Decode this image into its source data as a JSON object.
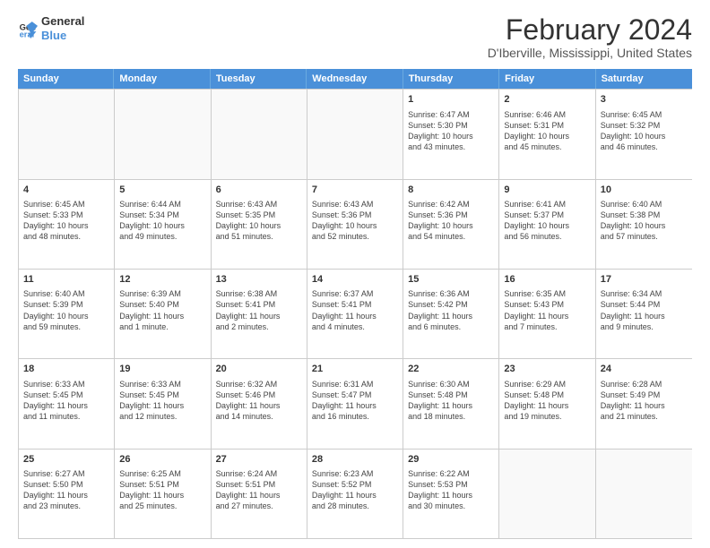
{
  "logo": {
    "line1": "General",
    "line2": "Blue"
  },
  "title": "February 2024",
  "location": "D'Iberville, Mississippi, United States",
  "days_of_week": [
    "Sunday",
    "Monday",
    "Tuesday",
    "Wednesday",
    "Thursday",
    "Friday",
    "Saturday"
  ],
  "weeks": [
    [
      {
        "day": "",
        "empty": true
      },
      {
        "day": "",
        "empty": true
      },
      {
        "day": "",
        "empty": true
      },
      {
        "day": "",
        "empty": true
      },
      {
        "day": "1",
        "line1": "Sunrise: 6:47 AM",
        "line2": "Sunset: 5:30 PM",
        "line3": "Daylight: 10 hours",
        "line4": "and 43 minutes."
      },
      {
        "day": "2",
        "line1": "Sunrise: 6:46 AM",
        "line2": "Sunset: 5:31 PM",
        "line3": "Daylight: 10 hours",
        "line4": "and 45 minutes."
      },
      {
        "day": "3",
        "line1": "Sunrise: 6:45 AM",
        "line2": "Sunset: 5:32 PM",
        "line3": "Daylight: 10 hours",
        "line4": "and 46 minutes."
      }
    ],
    [
      {
        "day": "4",
        "line1": "Sunrise: 6:45 AM",
        "line2": "Sunset: 5:33 PM",
        "line3": "Daylight: 10 hours",
        "line4": "and 48 minutes."
      },
      {
        "day": "5",
        "line1": "Sunrise: 6:44 AM",
        "line2": "Sunset: 5:34 PM",
        "line3": "Daylight: 10 hours",
        "line4": "and 49 minutes."
      },
      {
        "day": "6",
        "line1": "Sunrise: 6:43 AM",
        "line2": "Sunset: 5:35 PM",
        "line3": "Daylight: 10 hours",
        "line4": "and 51 minutes."
      },
      {
        "day": "7",
        "line1": "Sunrise: 6:43 AM",
        "line2": "Sunset: 5:36 PM",
        "line3": "Daylight: 10 hours",
        "line4": "and 52 minutes."
      },
      {
        "day": "8",
        "line1": "Sunrise: 6:42 AM",
        "line2": "Sunset: 5:36 PM",
        "line3": "Daylight: 10 hours",
        "line4": "and 54 minutes."
      },
      {
        "day": "9",
        "line1": "Sunrise: 6:41 AM",
        "line2": "Sunset: 5:37 PM",
        "line3": "Daylight: 10 hours",
        "line4": "and 56 minutes."
      },
      {
        "day": "10",
        "line1": "Sunrise: 6:40 AM",
        "line2": "Sunset: 5:38 PM",
        "line3": "Daylight: 10 hours",
        "line4": "and 57 minutes."
      }
    ],
    [
      {
        "day": "11",
        "line1": "Sunrise: 6:40 AM",
        "line2": "Sunset: 5:39 PM",
        "line3": "Daylight: 10 hours",
        "line4": "and 59 minutes."
      },
      {
        "day": "12",
        "line1": "Sunrise: 6:39 AM",
        "line2": "Sunset: 5:40 PM",
        "line3": "Daylight: 11 hours",
        "line4": "and 1 minute."
      },
      {
        "day": "13",
        "line1": "Sunrise: 6:38 AM",
        "line2": "Sunset: 5:41 PM",
        "line3": "Daylight: 11 hours",
        "line4": "and 2 minutes."
      },
      {
        "day": "14",
        "line1": "Sunrise: 6:37 AM",
        "line2": "Sunset: 5:41 PM",
        "line3": "Daylight: 11 hours",
        "line4": "and 4 minutes."
      },
      {
        "day": "15",
        "line1": "Sunrise: 6:36 AM",
        "line2": "Sunset: 5:42 PM",
        "line3": "Daylight: 11 hours",
        "line4": "and 6 minutes."
      },
      {
        "day": "16",
        "line1": "Sunrise: 6:35 AM",
        "line2": "Sunset: 5:43 PM",
        "line3": "Daylight: 11 hours",
        "line4": "and 7 minutes."
      },
      {
        "day": "17",
        "line1": "Sunrise: 6:34 AM",
        "line2": "Sunset: 5:44 PM",
        "line3": "Daylight: 11 hours",
        "line4": "and 9 minutes."
      }
    ],
    [
      {
        "day": "18",
        "line1": "Sunrise: 6:33 AM",
        "line2": "Sunset: 5:45 PM",
        "line3": "Daylight: 11 hours",
        "line4": "and 11 minutes."
      },
      {
        "day": "19",
        "line1": "Sunrise: 6:33 AM",
        "line2": "Sunset: 5:45 PM",
        "line3": "Daylight: 11 hours",
        "line4": "and 12 minutes."
      },
      {
        "day": "20",
        "line1": "Sunrise: 6:32 AM",
        "line2": "Sunset: 5:46 PM",
        "line3": "Daylight: 11 hours",
        "line4": "and 14 minutes."
      },
      {
        "day": "21",
        "line1": "Sunrise: 6:31 AM",
        "line2": "Sunset: 5:47 PM",
        "line3": "Daylight: 11 hours",
        "line4": "and 16 minutes."
      },
      {
        "day": "22",
        "line1": "Sunrise: 6:30 AM",
        "line2": "Sunset: 5:48 PM",
        "line3": "Daylight: 11 hours",
        "line4": "and 18 minutes."
      },
      {
        "day": "23",
        "line1": "Sunrise: 6:29 AM",
        "line2": "Sunset: 5:48 PM",
        "line3": "Daylight: 11 hours",
        "line4": "and 19 minutes."
      },
      {
        "day": "24",
        "line1": "Sunrise: 6:28 AM",
        "line2": "Sunset: 5:49 PM",
        "line3": "Daylight: 11 hours",
        "line4": "and 21 minutes."
      }
    ],
    [
      {
        "day": "25",
        "line1": "Sunrise: 6:27 AM",
        "line2": "Sunset: 5:50 PM",
        "line3": "Daylight: 11 hours",
        "line4": "and 23 minutes."
      },
      {
        "day": "26",
        "line1": "Sunrise: 6:25 AM",
        "line2": "Sunset: 5:51 PM",
        "line3": "Daylight: 11 hours",
        "line4": "and 25 minutes."
      },
      {
        "day": "27",
        "line1": "Sunrise: 6:24 AM",
        "line2": "Sunset: 5:51 PM",
        "line3": "Daylight: 11 hours",
        "line4": "and 27 minutes."
      },
      {
        "day": "28",
        "line1": "Sunrise: 6:23 AM",
        "line2": "Sunset: 5:52 PM",
        "line3": "Daylight: 11 hours",
        "line4": "and 28 minutes."
      },
      {
        "day": "29",
        "line1": "Sunrise: 6:22 AM",
        "line2": "Sunset: 5:53 PM",
        "line3": "Daylight: 11 hours",
        "line4": "and 30 minutes."
      },
      {
        "day": "",
        "empty": true
      },
      {
        "day": "",
        "empty": true
      }
    ]
  ]
}
